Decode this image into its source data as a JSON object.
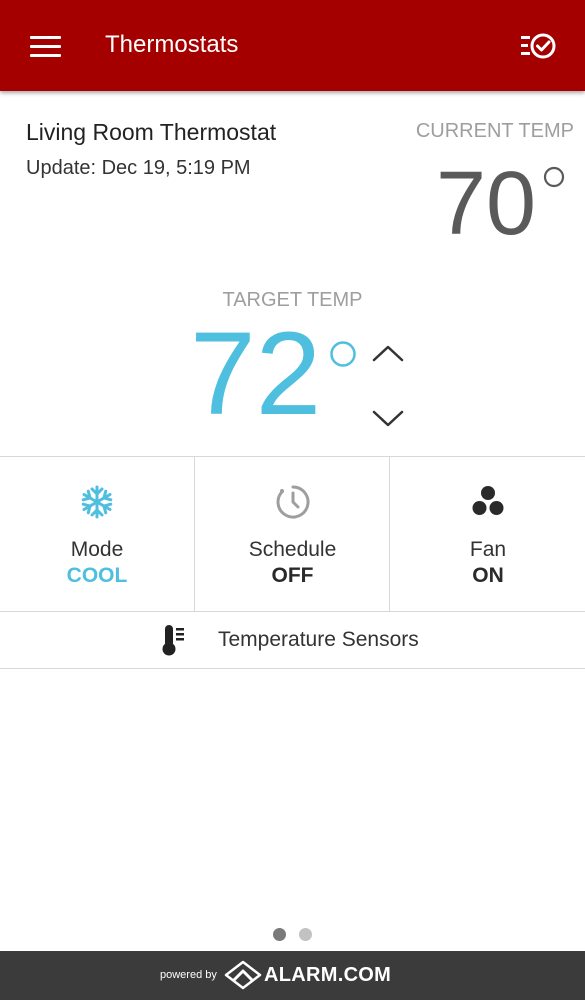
{
  "appbar": {
    "title": "Thermostats",
    "menu_icon": "hamburger-icon",
    "action_icon": "list-check-icon"
  },
  "thermostat": {
    "name": "Living Room Thermostat",
    "updated": "Update: Dec 19, 5:19 PM",
    "current_label": "CURRENT TEMP",
    "current_value": "70",
    "target_label": "TARGET TEMP",
    "target_value": "72"
  },
  "tiles": {
    "mode": {
      "label": "Mode",
      "value": "COOL",
      "icon": "snowflake-icon"
    },
    "schedule": {
      "label": "Schedule",
      "value": "OFF",
      "icon": "clock-icon"
    },
    "fan": {
      "label": "Fan",
      "value": "ON",
      "icon": "fan-icon"
    }
  },
  "sensors": {
    "label": "Temperature Sensors",
    "icon": "thermometer-icon"
  },
  "pager": {
    "count": 2,
    "active": 1
  },
  "footer": {
    "powered_by": "powered by",
    "brand": "ALARM.COM",
    "logo": "alarm-logo-icon"
  },
  "colors": {
    "header": "#a50000",
    "accent": "#4fbfdf",
    "footer": "#3b3b3b"
  }
}
